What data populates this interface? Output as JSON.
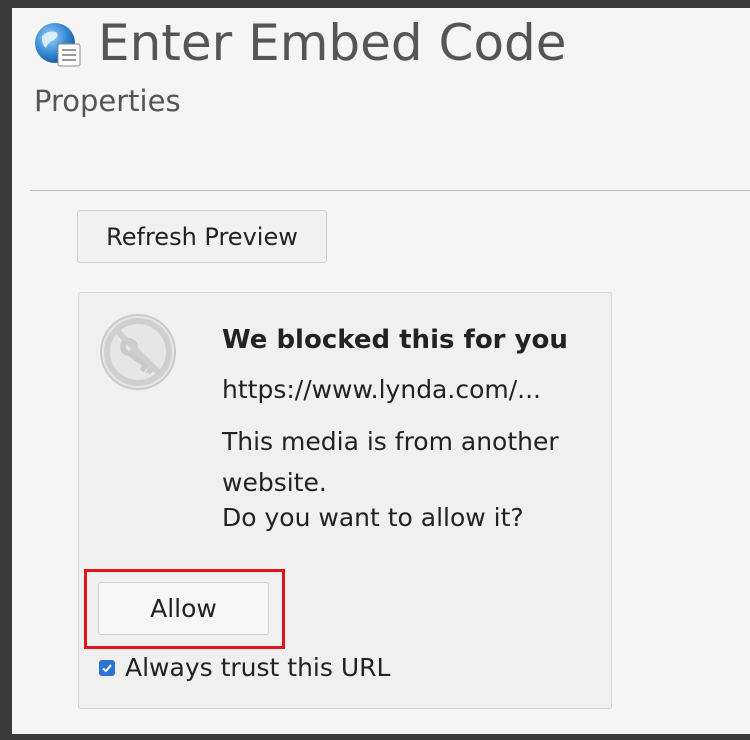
{
  "header": {
    "icon": "globe-document-icon",
    "title": "Enter Embed Code",
    "subtitle": "Properties"
  },
  "toolbar": {
    "refresh_label": "Refresh Preview"
  },
  "blocked": {
    "icon": "blocked-key-icon",
    "title": "We blocked this for you",
    "url": "https://www.lynda.com/...",
    "message": "This media is from another website.",
    "question": "Do you want to allow it?",
    "allow_label": "Allow",
    "trust_label": "Always trust this URL",
    "trust_checked": true
  },
  "colors": {
    "highlight": "#e5141b",
    "checkbox": "#2b74d6",
    "panel_background": "#f5f5f5",
    "frame": "#3a3a3a"
  }
}
